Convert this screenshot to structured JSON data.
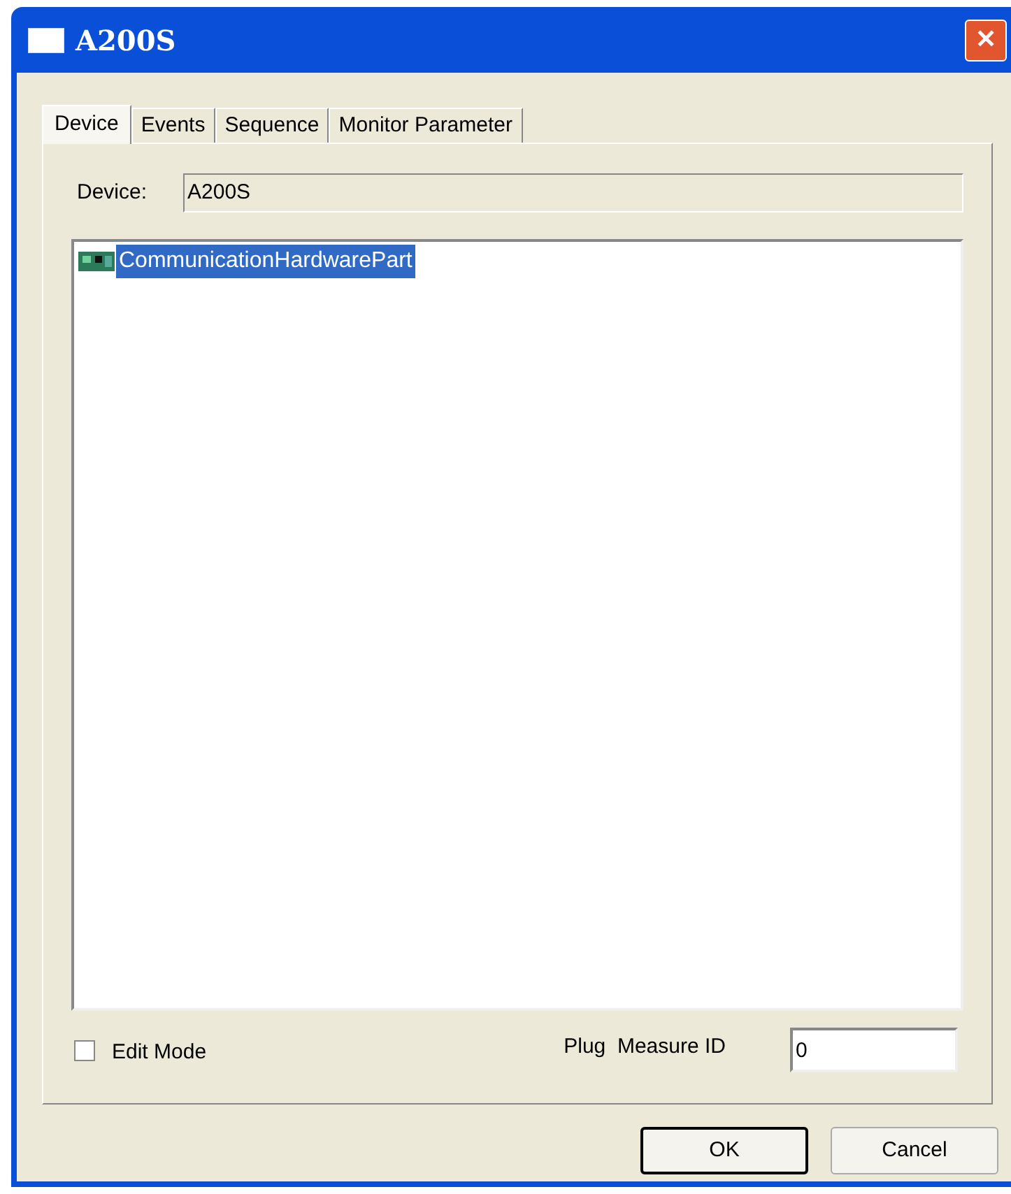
{
  "window": {
    "title": "A200S",
    "close": "✕"
  },
  "tabs": [
    {
      "label": "Device",
      "selected": true
    },
    {
      "label": "Events",
      "selected": false
    },
    {
      "label": "Sequence",
      "selected": false
    },
    {
      "label": "Monitor Parameter",
      "selected": false
    }
  ],
  "device": {
    "label": "Device:",
    "value": "A200S"
  },
  "tree": {
    "items": [
      {
        "label": "CommunicationHardwarePart",
        "selected": true
      }
    ]
  },
  "edit_mode": {
    "label": "Edit Mode",
    "checked": false
  },
  "plug_measure_id": {
    "label": "Plug  Measure ID",
    "value": "0"
  },
  "buttons": [
    {
      "label": "OK",
      "default": true
    },
    {
      "label": "Cancel",
      "default": false
    }
  ]
}
